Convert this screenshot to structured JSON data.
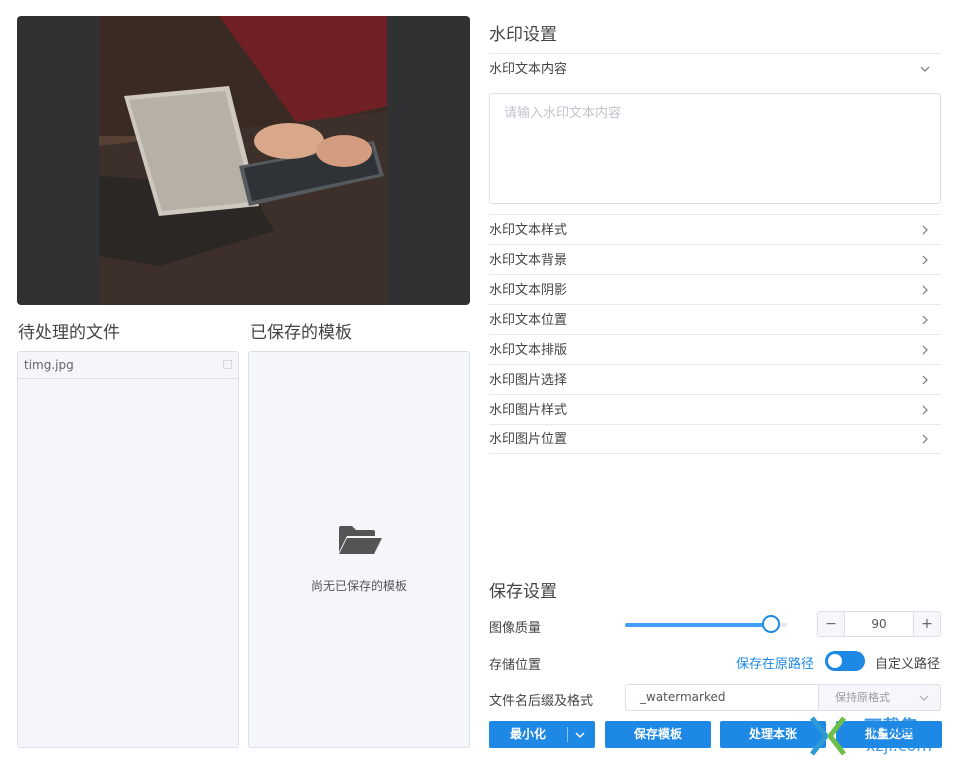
{
  "left": {
    "pending_files_title": "待处理的文件",
    "files": [
      "timg.jpg"
    ],
    "saved_templates_title": "已保存的模板",
    "templates_empty_text": "尚无已保存的模板"
  },
  "watermark_settings": {
    "title": "水印设置",
    "text_content_label": "水印文本内容",
    "text_placeholder": "请输入水印文本内容",
    "sections": [
      "水印文本样式",
      "水印文本背景",
      "水印文本阴影",
      "水印文本位置",
      "水印文本排版",
      "水印图片选择",
      "水印图片样式",
      "水印图片位置"
    ]
  },
  "save_settings": {
    "title": "保存设置",
    "quality_label": "图像质量",
    "quality_value": 90,
    "quality_fraction": 0.9,
    "decrement": "−",
    "increment": "+",
    "location_label": "存储位置",
    "location_option_original": "保存在原路径",
    "location_option_custom": "自定义路径",
    "suffix_label": "文件名后缀及格式",
    "suffix_value": "_watermarked",
    "format_value": "保持原格式"
  },
  "buttons": {
    "minimize": "最小化",
    "save_template": "保存模板",
    "process_this": "处理本张",
    "batch_process": "批量处理"
  },
  "overlay": {
    "site_name": "下载集",
    "site_url": "xzji.com"
  },
  "colors": {
    "accent": "#1e88e5",
    "panel_bg": "#f5f6fa"
  }
}
